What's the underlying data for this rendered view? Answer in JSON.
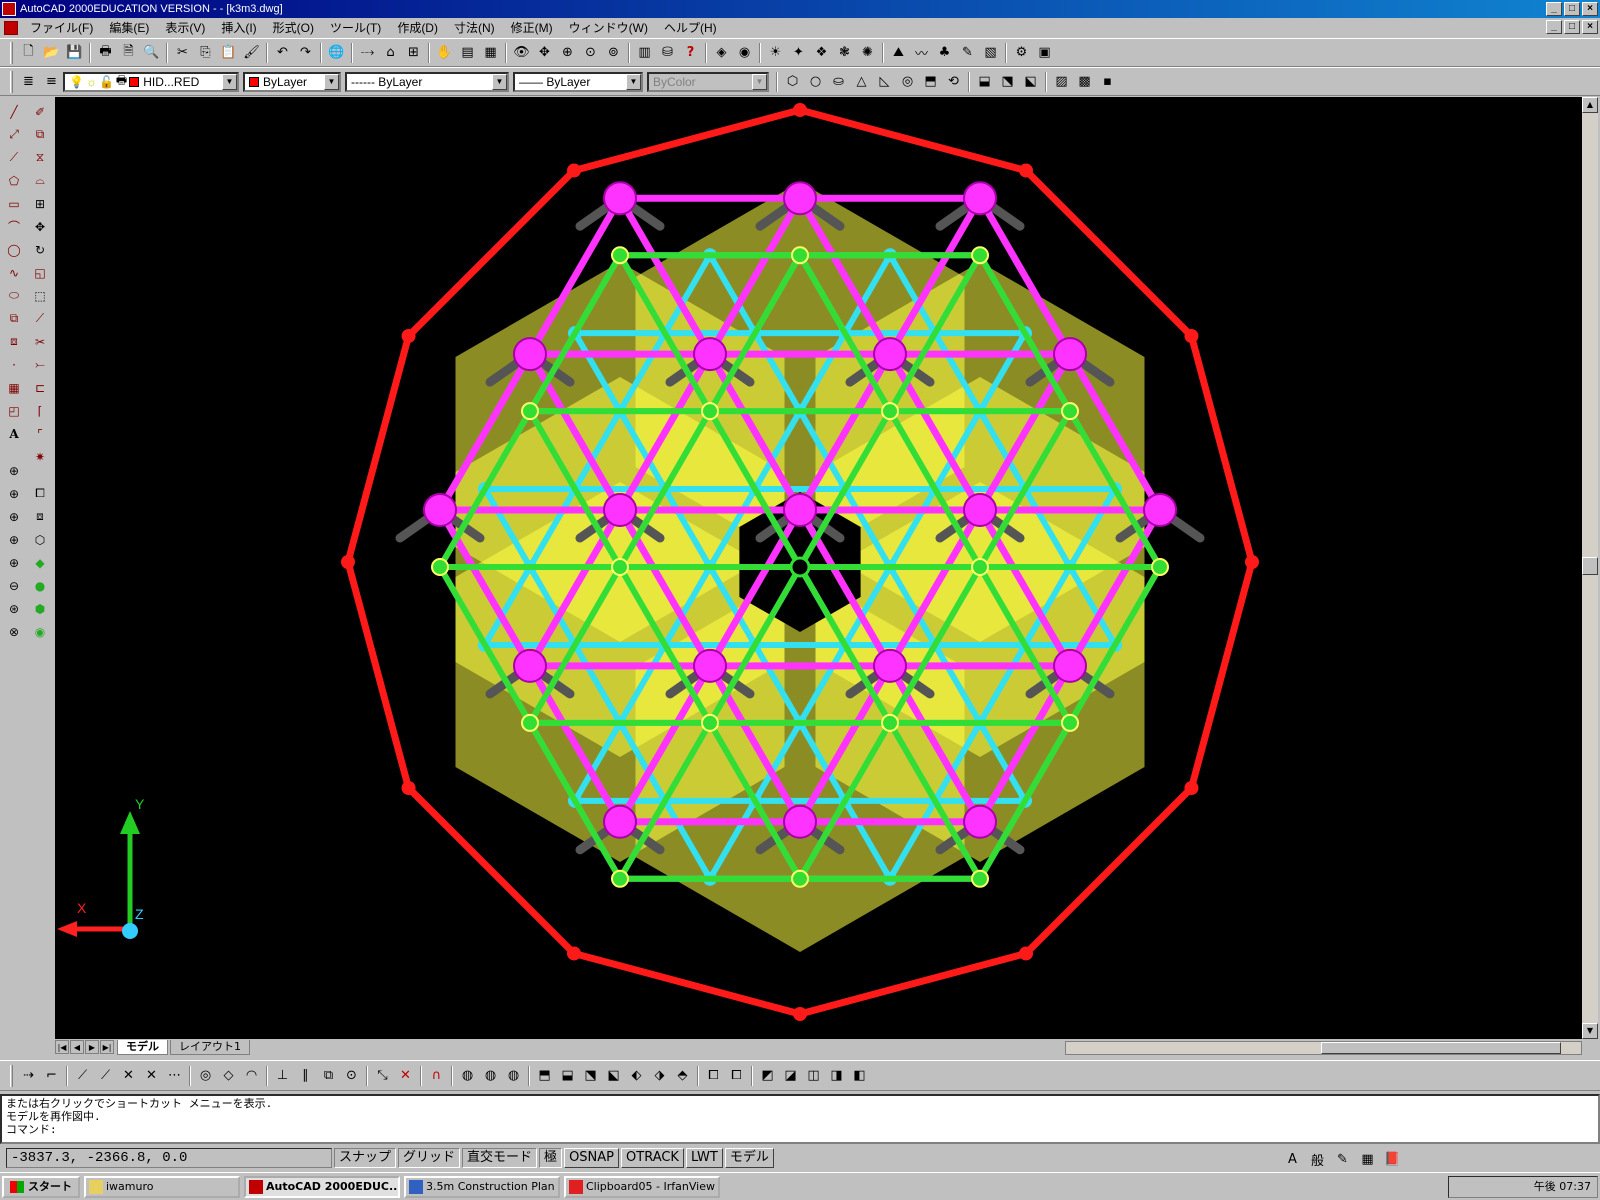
{
  "window": {
    "title": "AutoCAD 2000EDUCATION VERSION - - [k3m3.dwg]"
  },
  "menu": [
    "ファイル(F)",
    "編集(E)",
    "表示(V)",
    "挿入(I)",
    "形式(O)",
    "ツール(T)",
    "作成(D)",
    "寸法(N)",
    "修正(M)",
    "ウィンドウ(W)",
    "ヘルプ(H)"
  ],
  "properties": {
    "layer": "HID...RED",
    "color": "ByLayer",
    "linetype": "------ ByLayer",
    "lineweight": "—— ByLayer",
    "plotstyle": "ByColor"
  },
  "tabs": {
    "model": "モデル",
    "layout": "レイアウト1"
  },
  "command_lines": [
    "または右クリックでショートカット メニューを表示.",
    "モデルを再作図中.",
    "コマンド:"
  ],
  "status": {
    "coords": "-3837.3, -2366.8, 0.0",
    "toggles": [
      "スナップ",
      "グリッド",
      "直交モード",
      "極",
      "OSNAP",
      "OTRACK",
      "LWT",
      "モデル"
    ]
  },
  "taskbar": {
    "start": "スタート",
    "items": [
      "iwamuro",
      "AutoCAD 2000EDUC...",
      "3.5m Construction Plan -...",
      "Clipboard05 - IrfanView"
    ],
    "clock": "午後 07:37"
  },
  "ucs": {
    "x": "X",
    "y": "Y",
    "z": "Z"
  },
  "model_colors": {
    "outer": "#ff1a1a",
    "magenta": "#ff33ff",
    "green": "#33dd33",
    "cyan": "#33e0f0",
    "yellow": "#ffff44",
    "gray": "#555555"
  }
}
